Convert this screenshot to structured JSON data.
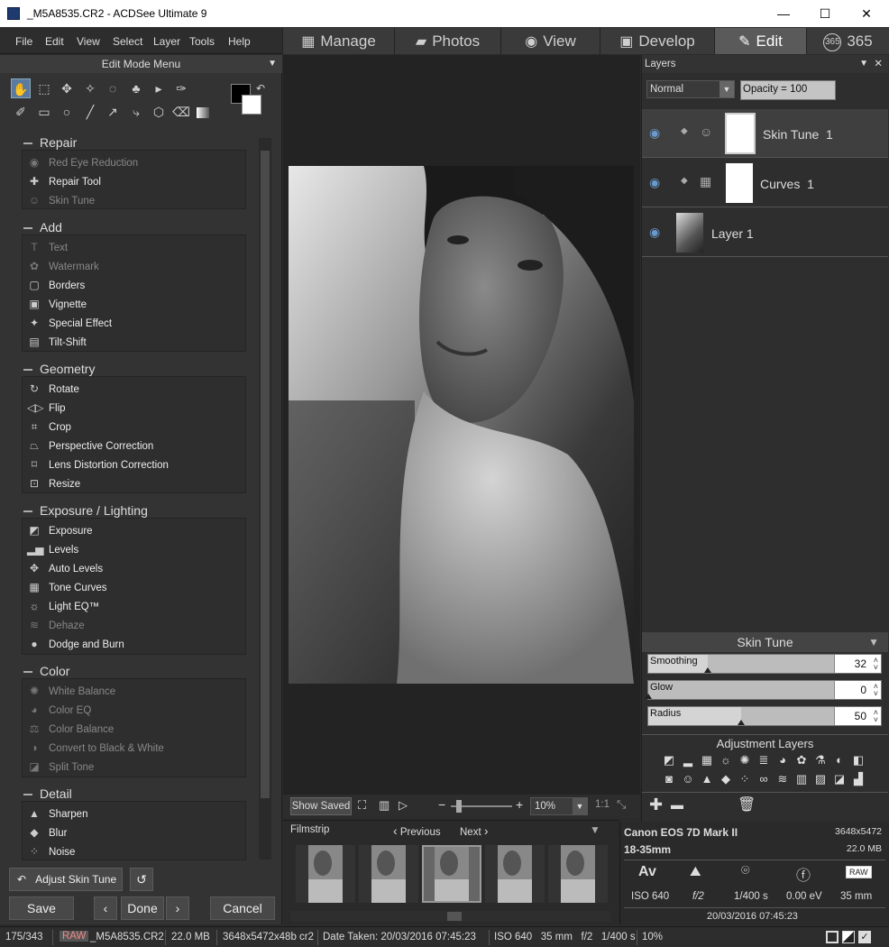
{
  "window": {
    "title": "_M5A8535.CR2 - ACDSee Ultimate 9",
    "minimize": "—",
    "maximize": "☐",
    "close": "✕"
  },
  "menus": [
    "File",
    "Edit",
    "View",
    "Select",
    "Layer",
    "Tools",
    "Help"
  ],
  "modes": [
    {
      "label": "Manage",
      "icon": "grid-icon"
    },
    {
      "label": "Photos",
      "icon": "photos-icon"
    },
    {
      "label": "View",
      "icon": "eye-icon"
    },
    {
      "label": "Develop",
      "icon": "develop-icon"
    },
    {
      "label": "Edit",
      "icon": "edit-icon"
    },
    {
      "label": "365",
      "icon": "365-icon",
      "badge": "365"
    }
  ],
  "left": {
    "header": "Edit Mode Menu",
    "categories": [
      {
        "name": "Repair",
        "items": [
          {
            "label": "Red Eye Reduction",
            "enabled": false,
            "icon": "eye-icon"
          },
          {
            "label": "Repair Tool",
            "enabled": true,
            "icon": "bandage-icon"
          },
          {
            "label": "Skin Tune",
            "enabled": false,
            "icon": "person-icon"
          }
        ]
      },
      {
        "name": "Add",
        "items": [
          {
            "label": "Text",
            "enabled": false,
            "icon": "text-icon"
          },
          {
            "label": "Watermark",
            "enabled": false,
            "icon": "watermark-icon"
          },
          {
            "label": "Borders",
            "enabled": true,
            "icon": "border-icon"
          },
          {
            "label": "Vignette",
            "enabled": true,
            "icon": "vignette-icon"
          },
          {
            "label": "Special Effect",
            "enabled": true,
            "icon": "wand-icon"
          },
          {
            "label": "Tilt-Shift",
            "enabled": true,
            "icon": "tiltshift-icon"
          }
        ]
      },
      {
        "name": "Geometry",
        "items": [
          {
            "label": "Rotate",
            "enabled": true,
            "icon": "rotate-icon"
          },
          {
            "label": "Flip",
            "enabled": true,
            "icon": "flip-icon"
          },
          {
            "label": "Crop",
            "enabled": true,
            "icon": "crop-icon"
          },
          {
            "label": "Perspective Correction",
            "enabled": true,
            "icon": "perspective-icon"
          },
          {
            "label": "Lens Distortion Correction",
            "enabled": true,
            "icon": "lens-icon"
          },
          {
            "label": "Resize",
            "enabled": true,
            "icon": "resize-icon"
          }
        ]
      },
      {
        "name": "Exposure / Lighting",
        "items": [
          {
            "label": "Exposure",
            "enabled": true,
            "icon": "exposure-icon"
          },
          {
            "label": "Levels",
            "enabled": true,
            "icon": "levels-icon"
          },
          {
            "label": "Auto Levels",
            "enabled": true,
            "icon": "autolevels-icon"
          },
          {
            "label": "Tone Curves",
            "enabled": true,
            "icon": "curves-icon"
          },
          {
            "label": "Light EQ™",
            "enabled": true,
            "icon": "sun-icon"
          },
          {
            "label": "Dehaze",
            "enabled": false,
            "icon": "dehaze-icon"
          },
          {
            "label": "Dodge and Burn",
            "enabled": true,
            "icon": "dodge-icon"
          }
        ]
      },
      {
        "name": "Color",
        "items": [
          {
            "label": "White Balance",
            "enabled": false,
            "icon": "whitebalance-icon"
          },
          {
            "label": "Color EQ",
            "enabled": false,
            "icon": "palette-icon"
          },
          {
            "label": "Color Balance",
            "enabled": false,
            "icon": "balance-icon"
          },
          {
            "label": "Convert to Black & White",
            "enabled": false,
            "icon": "bw-icon"
          },
          {
            "label": "Split Tone",
            "enabled": false,
            "icon": "splittone-icon"
          }
        ]
      },
      {
        "name": "Detail",
        "items": [
          {
            "label": "Sharpen",
            "enabled": true,
            "icon": "sharpen-icon"
          },
          {
            "label": "Blur",
            "enabled": true,
            "icon": "drop-icon"
          },
          {
            "label": "Noise",
            "enabled": true,
            "icon": "noise-icon"
          }
        ]
      }
    ],
    "adjust_label": "Adjust Skin Tune",
    "save": "Save",
    "done": "Done",
    "cancel": "Cancel"
  },
  "viewbar": {
    "show_saved": "Show Saved",
    "zoom": "10%",
    "one_to_one": "1:1"
  },
  "filmstrip": {
    "title": "Filmstrip",
    "previous": "Previous",
    "next": "Next"
  },
  "layers": {
    "title": "Layers",
    "blend_mode": "Normal",
    "opacity": "Opacity = 100",
    "items": [
      {
        "name": "Skin Tune  1",
        "selected": true
      },
      {
        "name": "Curves  1",
        "selected": false
      },
      {
        "name": "Layer 1",
        "selected": false
      }
    ]
  },
  "skin_tune": {
    "title": "Skin Tune",
    "sliders": [
      {
        "label": "Smoothing",
        "value": "32",
        "fraction": 0.32
      },
      {
        "label": "Glow",
        "value": "0",
        "fraction": 0.0
      },
      {
        "label": "Radius",
        "value": "50",
        "fraction": 0.5
      }
    ]
  },
  "adjustment_layers": {
    "title": "Adjustment Layers"
  },
  "info": {
    "camera": "Canon EOS 7D Mark II",
    "resolution": "3648x5472",
    "lens": "18-35mm",
    "size": "22.0 MB",
    "mode": "Av",
    "iso": "ISO 640",
    "aperture": "f/2",
    "shutter": "1/400 s",
    "ev": "0.00 eV",
    "focal": "35 mm",
    "date": "20/03/2016 07:45:23",
    "raw_badge": "RAW"
  },
  "status": {
    "count": "175/343",
    "raw": "RAW",
    "filename": "_M5A8535.CR2",
    "size": "22.0 MB",
    "dims": "3648x5472x48b cr2",
    "date_taken": "Date Taken: 20/03/2016 07:45:23",
    "exif": "ISO 640   35 mm   f/2   1/400 s",
    "zoom": "10%"
  }
}
